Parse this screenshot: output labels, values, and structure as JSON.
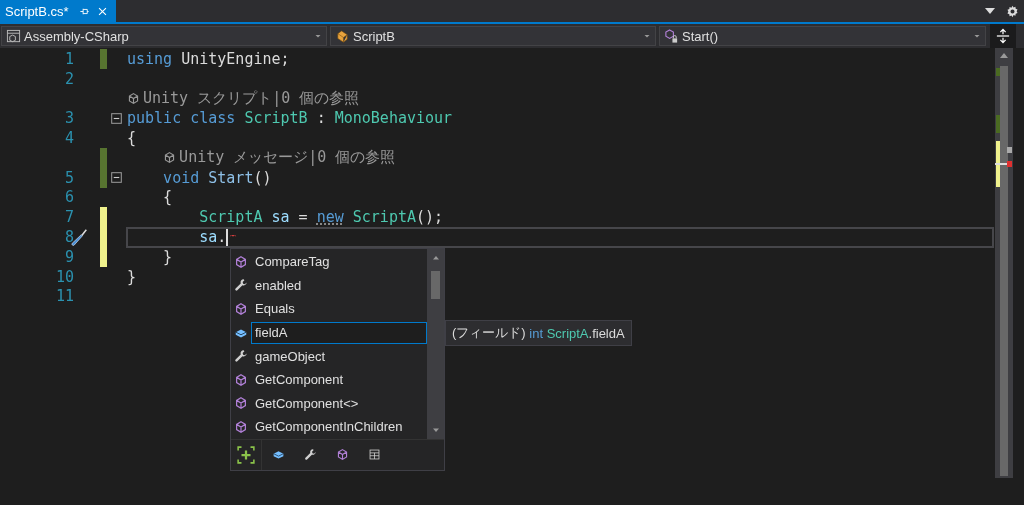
{
  "tabs": [
    {
      "label": "ScriptB.cs*",
      "selected": true
    }
  ],
  "navigation": [
    {
      "kind": "project",
      "label": "Assembly-CSharp"
    },
    {
      "kind": "class",
      "label": "ScriptB"
    },
    {
      "kind": "method",
      "label": "Start()"
    }
  ],
  "lines": [
    {
      "kind": "code",
      "number": "1",
      "change_marker": {
        "color": "#577430"
      },
      "tokens": [
        {
          "kind": "keyword",
          "text": "using "
        },
        {
          "kind": "plain",
          "text": "UnityEngine;"
        }
      ]
    },
    {
      "kind": "code",
      "number": "2"
    },
    {
      "kind": "lens",
      "text": "Unity スクリプト|0 個の参照"
    },
    {
      "kind": "code",
      "number": "3",
      "fold_box": {
        "expanded": true
      },
      "tokens": [
        {
          "kind": "keyword",
          "text": "public class "
        },
        {
          "kind": "type",
          "text": "ScriptB"
        },
        {
          "kind": "plain",
          "text": " : "
        },
        {
          "kind": "type",
          "text": "MonoBehaviour"
        }
      ]
    },
    {
      "kind": "code",
      "number": "4",
      "tokens": [
        {
          "kind": "plain",
          "text": "{"
        }
      ]
    },
    {
      "kind": "lens",
      "text": "Unity メッセージ|0 個の参照",
      "change_marker": {
        "color": "#577430"
      }
    },
    {
      "kind": "code",
      "number": "5",
      "change_marker": {
        "color": "#577430"
      },
      "fold_box": {
        "expanded": true
      },
      "tokens": [
        {
          "kind": "keyword",
          "text": "    void "
        },
        {
          "kind": "method",
          "text": "Start"
        },
        {
          "kind": "plain",
          "text": "()"
        }
      ]
    },
    {
      "kind": "code",
      "number": "6",
      "tokens": [
        {
          "kind": "plain",
          "text": "    {"
        }
      ]
    },
    {
      "kind": "code",
      "number": "7",
      "change_marker": {
        "color": "#eff18c"
      },
      "tokens": [
        {
          "kind": "type",
          "text": "        ScriptA "
        },
        {
          "kind": "variable",
          "text": "sa"
        },
        {
          "kind": "plain",
          "text": " = "
        },
        {
          "kind": "keyword",
          "text": "new",
          "squiggle": true
        },
        {
          "kind": "type",
          "text": " ScriptA"
        },
        {
          "kind": "plain",
          "text": "();"
        }
      ]
    },
    {
      "kind": "code",
      "number": "8",
      "change_marker": {
        "color": "#eff18c"
      },
      "current": true,
      "caret": true,
      "tokens": [
        {
          "kind": "variable",
          "text": "        sa"
        },
        {
          "kind": "plain",
          "text": "."
        }
      ]
    },
    {
      "kind": "code",
      "number": "9",
      "change_marker": {
        "color": "#eff18c"
      },
      "tokens": [
        {
          "kind": "plain",
          "text": "    }"
        }
      ]
    },
    {
      "kind": "code",
      "number": "10",
      "tokens": [
        {
          "kind": "plain",
          "text": "}"
        }
      ]
    },
    {
      "kind": "code",
      "number": "11"
    }
  ],
  "completion": {
    "items": [
      {
        "kind": "method",
        "label": "CompareTag",
        "selected": false
      },
      {
        "kind": "property",
        "label": "enabled",
        "selected": false
      },
      {
        "kind": "method",
        "label": "Equals",
        "selected": false
      },
      {
        "kind": "field",
        "label": "fieldA",
        "selected": true
      },
      {
        "kind": "property",
        "label": "gameObject",
        "selected": false
      },
      {
        "kind": "method",
        "label": "GetComponent",
        "selected": false
      },
      {
        "kind": "method",
        "label": "GetComponent<>",
        "selected": false
      },
      {
        "kind": "method",
        "label": "GetComponentInChildren",
        "selected": false
      }
    ],
    "filters": [
      {
        "kind": "expand"
      },
      {
        "kind": "field"
      },
      {
        "kind": "property"
      },
      {
        "kind": "method"
      },
      {
        "kind": "grid"
      }
    ],
    "tooltip": [
      {
        "kind": "plain",
        "text": "(フィールド) "
      },
      {
        "kind": "keyword",
        "text": "int "
      },
      {
        "kind": "type",
        "text": "ScriptA"
      },
      {
        "kind": "plain",
        "text": ".fieldA"
      }
    ]
  }
}
